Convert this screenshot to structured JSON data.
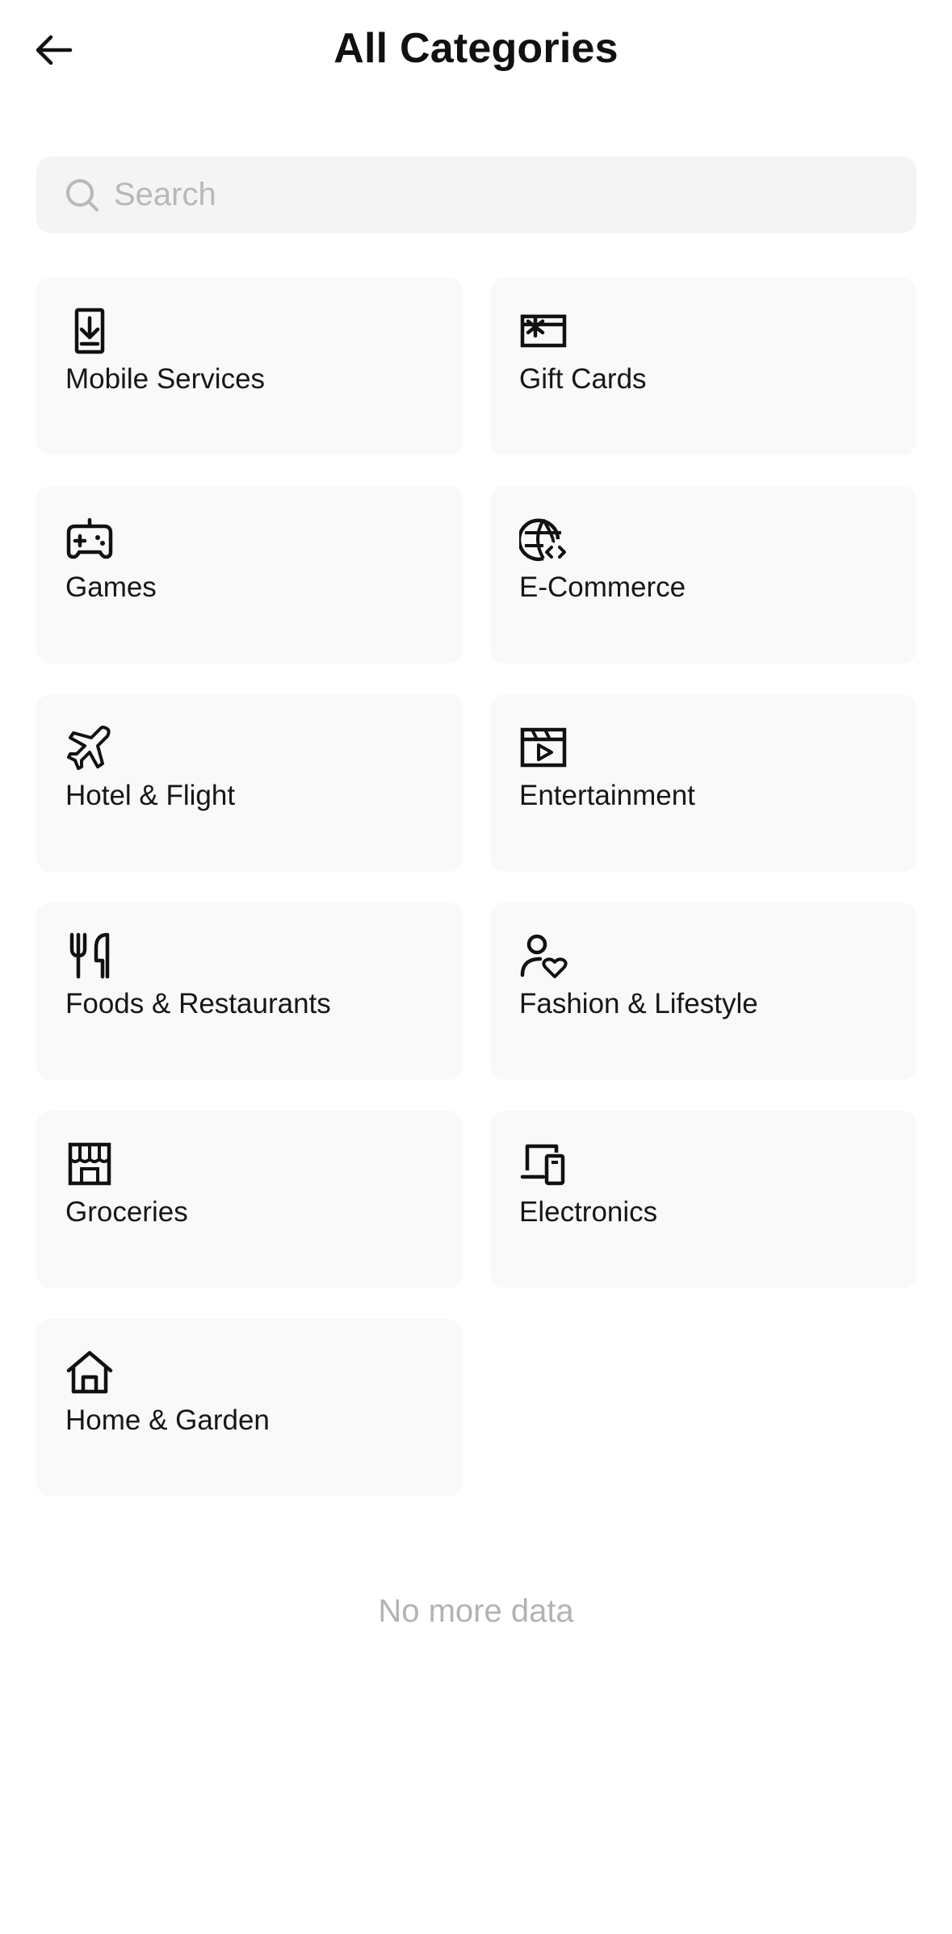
{
  "header": {
    "title": "All Categories",
    "back_icon": "arrow-left-icon"
  },
  "search": {
    "placeholder": "Search",
    "value": "",
    "icon": "search-icon"
  },
  "categories": [
    {
      "label": "Mobile Services",
      "icon": "phone-download-icon"
    },
    {
      "label": "Gift Cards",
      "icon": "gift-card-icon"
    },
    {
      "label": "Games",
      "icon": "gamepad-icon"
    },
    {
      "label": "E-Commerce",
      "icon": "globe-code-icon"
    },
    {
      "label": "Hotel & Flight",
      "icon": "airplane-icon"
    },
    {
      "label": "Entertainment",
      "icon": "video-clapper-icon"
    },
    {
      "label": "Foods & Restaurants",
      "icon": "fork-knife-icon"
    },
    {
      "label": "Fashion & Lifestyle",
      "icon": "person-heart-icon"
    },
    {
      "label": "Groceries",
      "icon": "storefront-icon"
    },
    {
      "label": "Electronics",
      "icon": "devices-icon"
    },
    {
      "label": "Home & Garden",
      "icon": "house-icon"
    }
  ],
  "footer": {
    "end_message": "No more data"
  },
  "colors": {
    "background": "#ffffff",
    "card_background": "#f9f9f9",
    "search_background": "#f4f4f4",
    "text": "#111111",
    "muted_text": "#b3b3b3"
  }
}
